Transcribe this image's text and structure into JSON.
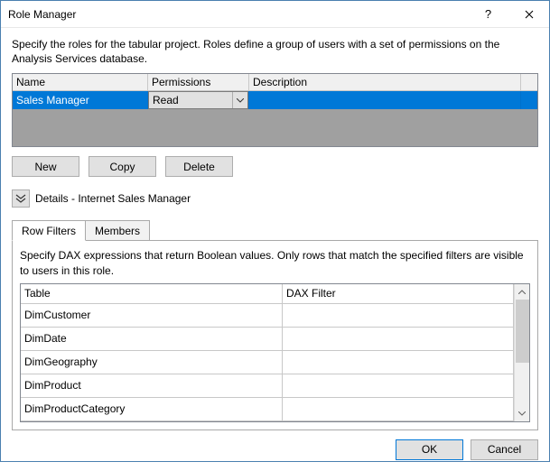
{
  "window": {
    "title": "Role Manager"
  },
  "instructions": "Specify the roles for the tabular project. Roles define a group of users with a set of permissions on the Analysis Services database.",
  "roles_grid": {
    "headers": {
      "name": "Name",
      "permissions": "Permissions",
      "description": "Description"
    },
    "row": {
      "name": "Sales Manager",
      "permission": "Read",
      "description": ""
    }
  },
  "buttons": {
    "new": "New",
    "copy": "Copy",
    "delete": "Delete"
  },
  "details": {
    "label": "Details - Internet Sales Manager"
  },
  "tabs": {
    "row_filters": "Row Filters",
    "members": "Members"
  },
  "row_filters": {
    "instructions": "Specify DAX expressions that return Boolean values. Only rows that match the specified filters are visible to users in this role.",
    "headers": {
      "table": "Table",
      "dax": "DAX Filter"
    },
    "rows": [
      {
        "table": "DimCustomer",
        "dax": ""
      },
      {
        "table": "DimDate",
        "dax": ""
      },
      {
        "table": "DimGeography",
        "dax": ""
      },
      {
        "table": "DimProduct",
        "dax": ""
      },
      {
        "table": "DimProductCategory",
        "dax": ""
      }
    ]
  },
  "footer": {
    "ok": "OK",
    "cancel": "Cancel"
  }
}
